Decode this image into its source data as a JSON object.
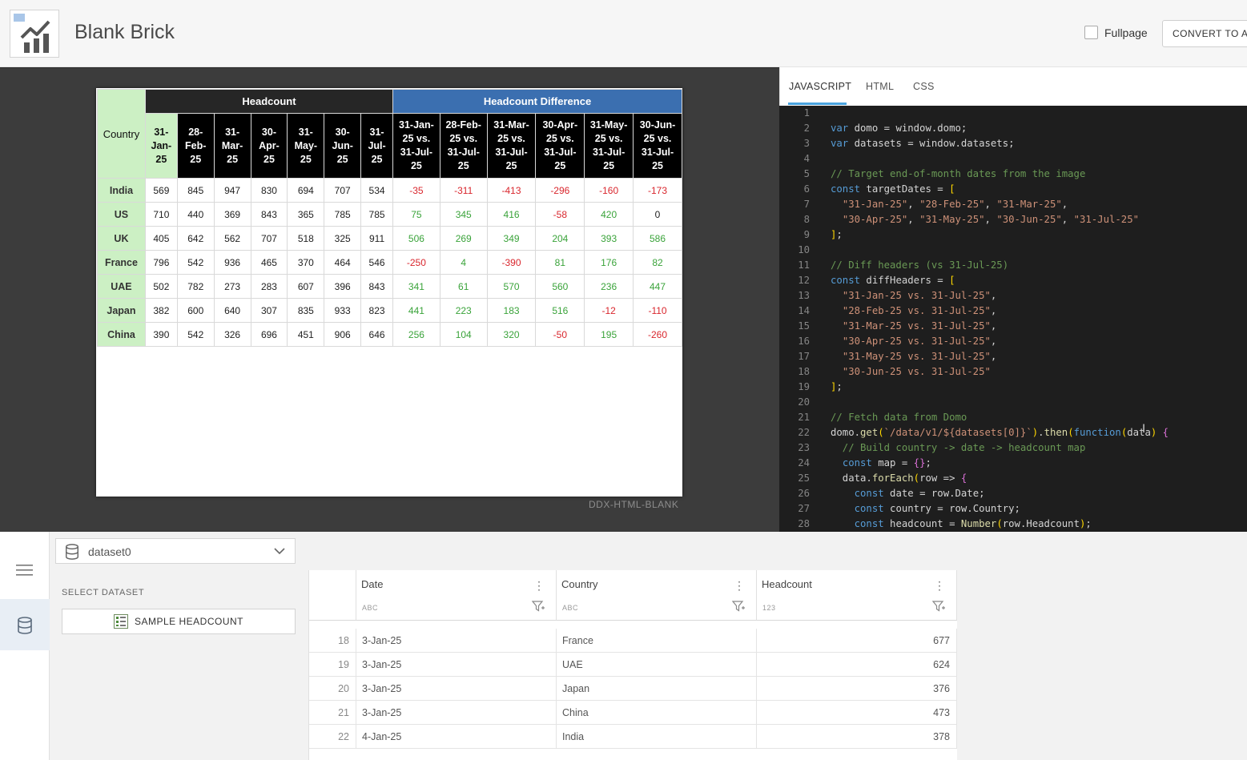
{
  "header": {
    "title": "Blank Brick",
    "fullpage_label": "Fullpage",
    "convert_label": "CONVERT TO AI"
  },
  "preview": {
    "footer_label": "DDX-HTML-BLANK",
    "table": {
      "country_header": "Country",
      "group_headcount": "Headcount",
      "group_diff": "Headcount Difference",
      "date_headers": [
        "31-Jan-25",
        "28-Feb-25",
        "31-Mar-25",
        "30-Apr-25",
        "31-May-25",
        "30-Jun-25",
        "31-Jul-25"
      ],
      "diff_headers": [
        "31-Jan-25 vs. 31-Jul-25",
        "28-Feb-25 vs. 31-Jul-25",
        "31-Mar-25 vs. 31-Jul-25",
        "30-Apr-25 vs. 31-Jul-25",
        "31-May-25 vs. 31-Jul-25",
        "30-Jun-25 vs. 31-Jul-25"
      ],
      "rows": [
        {
          "country": "India",
          "values": [
            569,
            845,
            947,
            830,
            694,
            707,
            534
          ],
          "diffs": [
            -35,
            -311,
            -413,
            -296,
            -160,
            -173
          ]
        },
        {
          "country": "US",
          "values": [
            710,
            440,
            369,
            843,
            365,
            785,
            785
          ],
          "diffs": [
            75,
            345,
            416,
            -58,
            420,
            0
          ]
        },
        {
          "country": "UK",
          "values": [
            405,
            642,
            562,
            707,
            518,
            325,
            911
          ],
          "diffs": [
            506,
            269,
            349,
            204,
            393,
            586
          ]
        },
        {
          "country": "France",
          "values": [
            796,
            542,
            936,
            465,
            370,
            464,
            546
          ],
          "diffs": [
            -250,
            4,
            -390,
            81,
            176,
            82
          ]
        },
        {
          "country": "UAE",
          "values": [
            502,
            782,
            273,
            283,
            607,
            396,
            843
          ],
          "diffs": [
            341,
            61,
            570,
            560,
            236,
            447
          ]
        },
        {
          "country": "Japan",
          "values": [
            382,
            600,
            640,
            307,
            835,
            933,
            823
          ],
          "diffs": [
            441,
            223,
            183,
            516,
            -12,
            -110
          ]
        },
        {
          "country": "China",
          "values": [
            390,
            542,
            326,
            696,
            451,
            906,
            646
          ],
          "diffs": [
            256,
            104,
            320,
            -50,
            195,
            -260
          ]
        }
      ],
      "colors": {
        "positive": "#3aa33a",
        "negative": "#d9262d",
        "country_bg": "#ccf0c4",
        "diff_header_bg": "#3b6fb0"
      }
    }
  },
  "editor": {
    "tabs": [
      "JAVASCRIPT",
      "HTML",
      "CSS"
    ],
    "active_tab": "JAVASCRIPT",
    "lines": [
      "",
      "var domo = window.domo;",
      "var datasets = window.datasets;",
      "",
      "// Target end-of-month dates from the image",
      "const targetDates = [",
      "  \"31-Jan-25\", \"28-Feb-25\", \"31-Mar-25\",",
      "  \"30-Apr-25\", \"31-May-25\", \"30-Jun-25\", \"31-Jul-25\"",
      "];",
      "",
      "// Diff headers (vs 31-Jul-25)",
      "const diffHeaders = [",
      "  \"31-Jan-25 vs. 31-Jul-25\",",
      "  \"28-Feb-25 vs. 31-Jul-25\",",
      "  \"31-Mar-25 vs. 31-Jul-25\",",
      "  \"30-Apr-25 vs. 31-Jul-25\",",
      "  \"31-May-25 vs. 31-Jul-25\",",
      "  \"30-Jun-25 vs. 31-Jul-25\"",
      "];",
      "",
      "// Fetch data from Domo",
      "domo.get(`/data/v1/${datasets[0]}`).then(function(data) {",
      "  // Build country -> date -> headcount map",
      "  const map = {};",
      "  data.forEach(row => {",
      "    const date = row.Date;",
      "    const country = row.Country;",
      "    const headcount = Number(row.Headcount);"
    ]
  },
  "bottom": {
    "dataset_select": "dataset0",
    "select_dataset_label": "SELECT DATASET",
    "sample_button": "SAMPLE HEADCOUNT",
    "grid": {
      "columns": [
        {
          "name": "Date",
          "type": "ABC"
        },
        {
          "name": "Country",
          "type": "ABC"
        },
        {
          "name": "Headcount",
          "type": "123"
        }
      ],
      "rows": [
        {
          "num": "18",
          "date": "3-Jan-25",
          "country": "France",
          "headcount": "677"
        },
        {
          "num": "19",
          "date": "3-Jan-25",
          "country": "UAE",
          "headcount": "624"
        },
        {
          "num": "20",
          "date": "3-Jan-25",
          "country": "Japan",
          "headcount": "376"
        },
        {
          "num": "21",
          "date": "3-Jan-25",
          "country": "China",
          "headcount": "473"
        },
        {
          "num": "22",
          "date": "4-Jan-25",
          "country": "India",
          "headcount": "378"
        }
      ]
    }
  }
}
